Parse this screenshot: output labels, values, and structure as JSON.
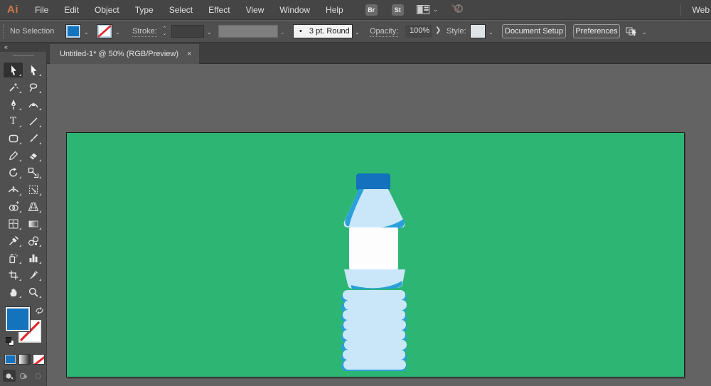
{
  "menubar": {
    "logo": "Ai",
    "items": [
      "File",
      "Edit",
      "Object",
      "Type",
      "Select",
      "Effect",
      "View",
      "Window",
      "Help"
    ],
    "bridge_label": "Br",
    "stock_label": "St",
    "workspace_name": "Web"
  },
  "control_bar": {
    "selection_status": "No Selection",
    "stroke_label": "Stroke:",
    "brush_preview_dot": "•",
    "brush_name": "3 pt. Round",
    "opacity_label": "Opacity:",
    "opacity_value": "100%",
    "style_label": "Style:",
    "document_setup_label": "Document Setup",
    "preferences_label": "Preferences"
  },
  "document_tab": {
    "title": "Untitled-1* @ 50% (RGB/Preview)",
    "close_glyph": "×"
  },
  "toolbar": {
    "collapse_glyph": "«",
    "type_tool_glyph": "T",
    "tools": [
      "selection",
      "direct-selection",
      "magic-wand",
      "lasso",
      "pen",
      "curvature",
      "type",
      "line-segment",
      "rectangle",
      "paintbrush",
      "pencil",
      "eraser",
      "rotate",
      "scale",
      "width",
      "free-transform",
      "shape-builder",
      "perspective-grid",
      "mesh",
      "gradient",
      "eyedropper",
      "blend",
      "symbol-sprayer",
      "column-graph",
      "artboard",
      "slice",
      "hand",
      "zoom"
    ],
    "selected_tool": "selection"
  },
  "swatches": {
    "fill_blue": "#1473BD",
    "stroke_none_red": "#E0282E",
    "style_light": "#DFE3E6"
  },
  "canvas": {
    "artboard_color": "#2DB673",
    "bottle": {
      "cap_color": "#1471BD",
      "body_color": "#C9E7F8",
      "accent_color": "#2A9FD9",
      "label_color": "#FDFDFE"
    }
  }
}
